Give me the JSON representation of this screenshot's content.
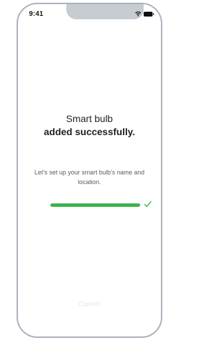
{
  "status_bar": {
    "time": "9:41",
    "icons": [
      "wifi-icon",
      "battery-icon"
    ]
  },
  "main": {
    "title_line1": "Smart bulb",
    "title_line2": "added successfully.",
    "description": "Let’s set up your smart bulb’s name and location.",
    "progress_fraction": 1.0,
    "progress_icon": "check-icon",
    "cancel_label": "Cancel"
  },
  "colors": {
    "accent": "#3ab44a",
    "frame": "#aab1bc",
    "notch": "#c7ccd3",
    "cancel_text": "#e3e6ea"
  }
}
